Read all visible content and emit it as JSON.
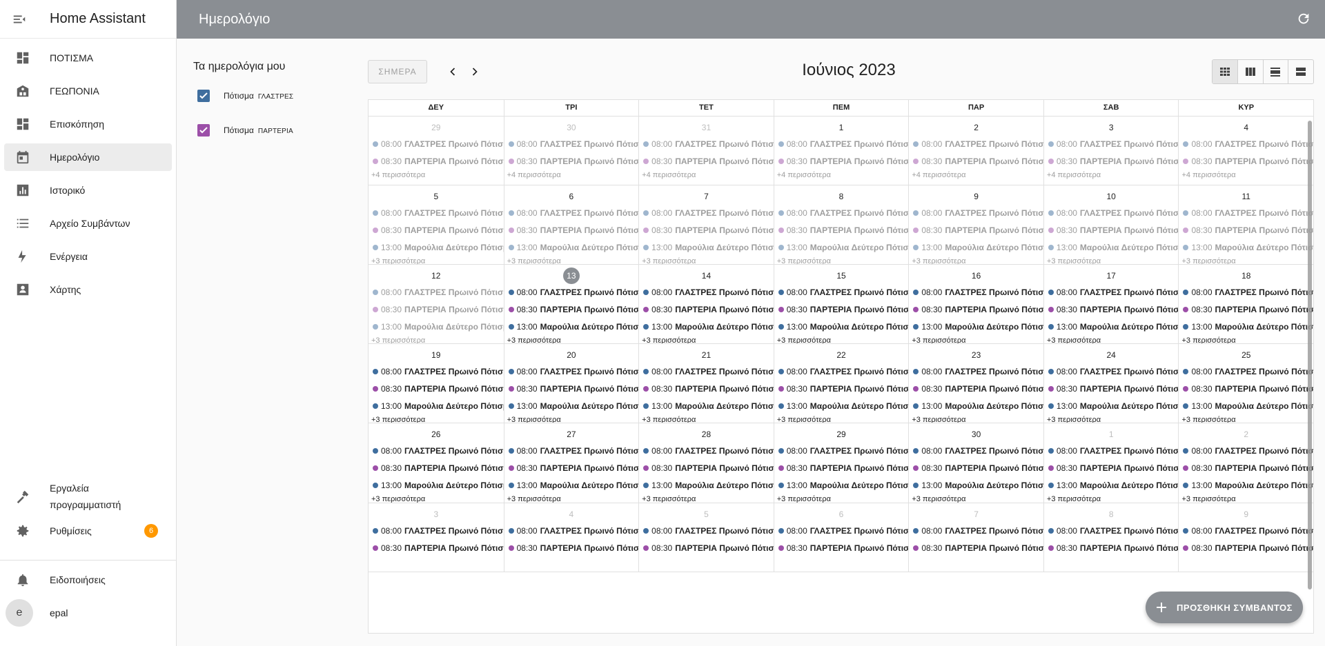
{
  "sidebar": {
    "app_title": "Home Assistant",
    "items": [
      {
        "label": "ΠΟΤΙΣΜΑ",
        "icon": "dashboard-icon"
      },
      {
        "label": "ΓΕΩΠΟΝΙΑ",
        "icon": "hotel-icon"
      },
      {
        "label": "Επισκόπηση",
        "icon": "dashboard-icon"
      },
      {
        "label": "Ημερολόγιο",
        "icon": "calendar-icon"
      },
      {
        "label": "Ιστορικό",
        "icon": "chart-box-icon"
      },
      {
        "label": "Αρχείο Συμβάντων",
        "icon": "list-icon"
      },
      {
        "label": "Ενέργεια",
        "icon": "lightning-icon"
      },
      {
        "label": "Χάρτης",
        "icon": "map-icon"
      }
    ],
    "developer_tools": "Εργαλεία προγραμματιστή",
    "settings": "Ρυθμίσεις",
    "settings_badge": "6",
    "notifications": "Ειδοποιήσεις",
    "user_initial": "e",
    "user_name": "epal"
  },
  "topbar": {
    "title": "Ημερολόγιο"
  },
  "calendars": {
    "heading": "Τα ημερολόγια μου",
    "items": [
      {
        "label": "Πότισμα",
        "sub": "ΓΛΑΣΤΡΕΣ",
        "color": "#3f6e9e"
      },
      {
        "label": "Πότισμα",
        "sub": "ΠΑΡΤΕΡΙΑ",
        "color": "#9c4fa8"
      }
    ]
  },
  "toolbar": {
    "today": "ΣΗΜΕΡΑ",
    "month_title": "Ιούνιος 2023"
  },
  "weekdays": [
    "ΔΕΥ",
    "ΤΡΙ",
    "ΤΕΤ",
    "ΠΕΜ",
    "ΠΑΡ",
    "ΣΑΒ",
    "ΚΥΡ"
  ],
  "events": {
    "glastres": {
      "time": "08:00",
      "name": "ΓΛΑΣΤΡΕΣ",
      "desc": "Πρωινό Πότισμα",
      "color": "#3f6e9e"
    },
    "parteria": {
      "time": "08:30",
      "name": "ΠΑΡΤΕΡΙΑ",
      "desc": "Πρωινό Πότισμα",
      "color": "#9c4fa8"
    },
    "maroulia": {
      "time": "13:00",
      "name": "Μαρούλια",
      "desc": "Δεύτερο Πότισμα",
      "color": "#3f6e9e"
    }
  },
  "weeks": [
    {
      "days": [
        "29",
        "30",
        "31",
        "1",
        "2",
        "3",
        "4"
      ],
      "other": [
        true,
        true,
        true,
        false,
        false,
        false,
        false
      ],
      "events": [
        "glastres",
        "parteria"
      ],
      "more": "+4 περισσότερα",
      "past": [
        true,
        true,
        true,
        true,
        true,
        true,
        true
      ],
      "height": 100
    },
    {
      "days": [
        "5",
        "6",
        "7",
        "8",
        "9",
        "10",
        "11"
      ],
      "other": [
        false,
        false,
        false,
        false,
        false,
        false,
        false
      ],
      "events": [
        "glastres",
        "parteria",
        "maroulia"
      ],
      "more": "+3 περισσότερα",
      "past": [
        true,
        true,
        true,
        true,
        true,
        true,
        true
      ],
      "height": 115
    },
    {
      "days": [
        "12",
        "13",
        "14",
        "15",
        "16",
        "17",
        "18"
      ],
      "other": [
        false,
        false,
        false,
        false,
        false,
        false,
        false
      ],
      "events": [
        "glastres",
        "parteria",
        "maroulia"
      ],
      "more": "+3 περισσότερα",
      "past": [
        true,
        false,
        false,
        false,
        false,
        false,
        false
      ],
      "today": 1,
      "height": 115
    },
    {
      "days": [
        "19",
        "20",
        "21",
        "22",
        "23",
        "24",
        "25"
      ],
      "other": [
        false,
        false,
        false,
        false,
        false,
        false,
        false
      ],
      "events": [
        "glastres",
        "parteria",
        "maroulia"
      ],
      "more": "+3 περισσότερα",
      "past": [
        false,
        false,
        false,
        false,
        false,
        false,
        false
      ],
      "height": 115
    },
    {
      "days": [
        "26",
        "27",
        "28",
        "29",
        "30",
        "1",
        "2"
      ],
      "other": [
        false,
        false,
        false,
        false,
        false,
        true,
        true
      ],
      "events": [
        "glastres",
        "parteria",
        "maroulia"
      ],
      "more": "+3 περισσότερα",
      "past": [
        false,
        false,
        false,
        false,
        false,
        false,
        false
      ],
      "height": 116
    },
    {
      "days": [
        "3",
        "4",
        "5",
        "6",
        "7",
        "8",
        "9"
      ],
      "other": [
        true,
        true,
        true,
        true,
        true,
        true,
        true
      ],
      "events": [
        "glastres",
        "parteria"
      ],
      "more": "",
      "past": [
        false,
        false,
        false,
        false,
        false,
        false,
        false
      ],
      "height": 100
    }
  ],
  "fab": {
    "label": "ΠΡΟΣΘΗΚΗ ΣΥΜΒΑΝΤΟΣ"
  },
  "colors": {
    "primary": "#8a8e93",
    "badge": "#ff9800"
  }
}
